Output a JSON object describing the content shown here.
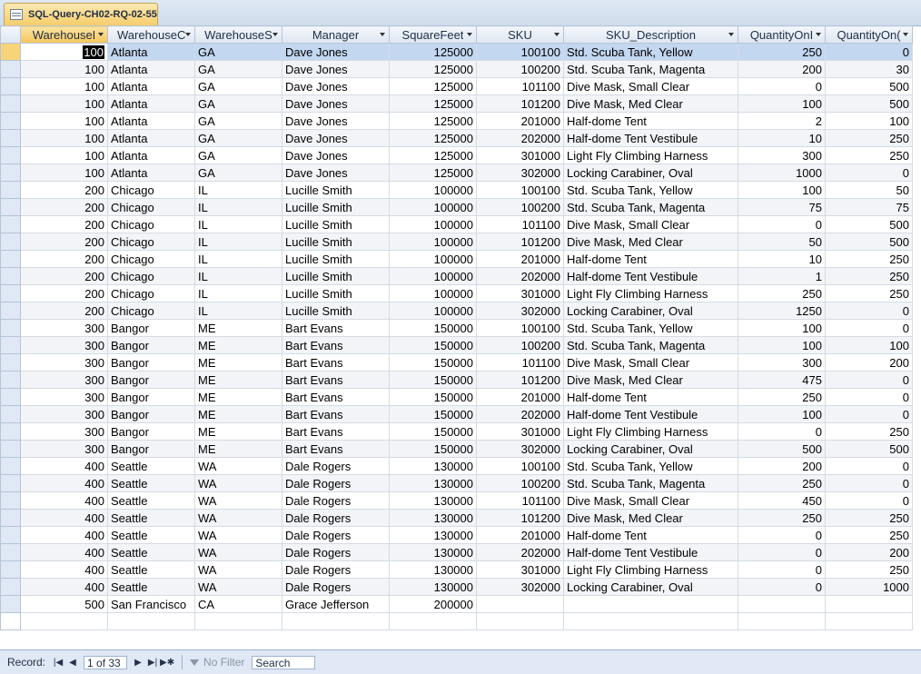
{
  "tab": {
    "title": "SQL-Query-CH02-RQ-02-55",
    "icon": "query-datasheet-icon"
  },
  "columns": [
    {
      "label": "WarehouseI",
      "dropdown": true
    },
    {
      "label": "WarehouseC",
      "dropdown": true
    },
    {
      "label": "WarehouseS",
      "dropdown": true
    },
    {
      "label": "Manager",
      "dropdown": true
    },
    {
      "label": "SquareFeet",
      "dropdown": true
    },
    {
      "label": "SKU",
      "dropdown": true
    },
    {
      "label": "SKU_Description",
      "dropdown": true
    },
    {
      "label": "QuantityOnI",
      "dropdown": true
    },
    {
      "label": "QuantityOn(",
      "dropdown": true
    }
  ],
  "rows": [
    [
      "100",
      "Atlanta",
      "GA",
      "Dave Jones",
      "125000",
      "100100",
      "Std. Scuba Tank, Yellow",
      "250",
      "0"
    ],
    [
      "100",
      "Atlanta",
      "GA",
      "Dave Jones",
      "125000",
      "100200",
      "Std. Scuba Tank, Magenta",
      "200",
      "30"
    ],
    [
      "100",
      "Atlanta",
      "GA",
      "Dave Jones",
      "125000",
      "101100",
      "Dive Mask, Small Clear",
      "0",
      "500"
    ],
    [
      "100",
      "Atlanta",
      "GA",
      "Dave Jones",
      "125000",
      "101200",
      "Dive Mask, Med Clear",
      "100",
      "500"
    ],
    [
      "100",
      "Atlanta",
      "GA",
      "Dave Jones",
      "125000",
      "201000",
      "Half-dome Tent",
      "2",
      "100"
    ],
    [
      "100",
      "Atlanta",
      "GA",
      "Dave Jones",
      "125000",
      "202000",
      "Half-dome Tent Vestibule",
      "10",
      "250"
    ],
    [
      "100",
      "Atlanta",
      "GA",
      "Dave Jones",
      "125000",
      "301000",
      "Light Fly Climbing Harness",
      "300",
      "250"
    ],
    [
      "100",
      "Atlanta",
      "GA",
      "Dave Jones",
      "125000",
      "302000",
      "Locking Carabiner, Oval",
      "1000",
      "0"
    ],
    [
      "200",
      "Chicago",
      "IL",
      "Lucille Smith",
      "100000",
      "100100",
      "Std. Scuba Tank, Yellow",
      "100",
      "50"
    ],
    [
      "200",
      "Chicago",
      "IL",
      "Lucille Smith",
      "100000",
      "100200",
      "Std. Scuba Tank, Magenta",
      "75",
      "75"
    ],
    [
      "200",
      "Chicago",
      "IL",
      "Lucille Smith",
      "100000",
      "101100",
      "Dive Mask, Small Clear",
      "0",
      "500"
    ],
    [
      "200",
      "Chicago",
      "IL",
      "Lucille Smith",
      "100000",
      "101200",
      "Dive Mask, Med Clear",
      "50",
      "500"
    ],
    [
      "200",
      "Chicago",
      "IL",
      "Lucille Smith",
      "100000",
      "201000",
      "Half-dome Tent",
      "10",
      "250"
    ],
    [
      "200",
      "Chicago",
      "IL",
      "Lucille Smith",
      "100000",
      "202000",
      "Half-dome Tent Vestibule",
      "1",
      "250"
    ],
    [
      "200",
      "Chicago",
      "IL",
      "Lucille Smith",
      "100000",
      "301000",
      "Light Fly Climbing Harness",
      "250",
      "250"
    ],
    [
      "200",
      "Chicago",
      "IL",
      "Lucille Smith",
      "100000",
      "302000",
      "Locking Carabiner, Oval",
      "1250",
      "0"
    ],
    [
      "300",
      "Bangor",
      "ME",
      "Bart Evans",
      "150000",
      "100100",
      "Std. Scuba Tank, Yellow",
      "100",
      "0"
    ],
    [
      "300",
      "Bangor",
      "ME",
      "Bart Evans",
      "150000",
      "100200",
      "Std. Scuba Tank, Magenta",
      "100",
      "100"
    ],
    [
      "300",
      "Bangor",
      "ME",
      "Bart Evans",
      "150000",
      "101100",
      "Dive Mask, Small Clear",
      "300",
      "200"
    ],
    [
      "300",
      "Bangor",
      "ME",
      "Bart Evans",
      "150000",
      "101200",
      "Dive Mask, Med Clear",
      "475",
      "0"
    ],
    [
      "300",
      "Bangor",
      "ME",
      "Bart Evans",
      "150000",
      "201000",
      "Half-dome Tent",
      "250",
      "0"
    ],
    [
      "300",
      "Bangor",
      "ME",
      "Bart Evans",
      "150000",
      "202000",
      "Half-dome Tent Vestibule",
      "100",
      "0"
    ],
    [
      "300",
      "Bangor",
      "ME",
      "Bart Evans",
      "150000",
      "301000",
      "Light Fly Climbing Harness",
      "0",
      "250"
    ],
    [
      "300",
      "Bangor",
      "ME",
      "Bart Evans",
      "150000",
      "302000",
      "Locking Carabiner, Oval",
      "500",
      "500"
    ],
    [
      "400",
      "Seattle",
      "WA",
      "Dale Rogers",
      "130000",
      "100100",
      "Std. Scuba Tank, Yellow",
      "200",
      "0"
    ],
    [
      "400",
      "Seattle",
      "WA",
      "Dale Rogers",
      "130000",
      "100200",
      "Std. Scuba Tank, Magenta",
      "250",
      "0"
    ],
    [
      "400",
      "Seattle",
      "WA",
      "Dale Rogers",
      "130000",
      "101100",
      "Dive Mask, Small Clear",
      "450",
      "0"
    ],
    [
      "400",
      "Seattle",
      "WA",
      "Dale Rogers",
      "130000",
      "101200",
      "Dive Mask, Med Clear",
      "250",
      "250"
    ],
    [
      "400",
      "Seattle",
      "WA",
      "Dale Rogers",
      "130000",
      "201000",
      "Half-dome Tent",
      "0",
      "250"
    ],
    [
      "400",
      "Seattle",
      "WA",
      "Dale Rogers",
      "130000",
      "202000",
      "Half-dome Tent Vestibule",
      "0",
      "200"
    ],
    [
      "400",
      "Seattle",
      "WA",
      "Dale Rogers",
      "130000",
      "301000",
      "Light Fly Climbing Harness",
      "0",
      "250"
    ],
    [
      "400",
      "Seattle",
      "WA",
      "Dale Rogers",
      "130000",
      "302000",
      "Locking Carabiner, Oval",
      "0",
      "1000"
    ],
    [
      "500",
      "San Francisco",
      "CA",
      "Grace Jefferson",
      "200000",
      "",
      "",
      "",
      ""
    ]
  ],
  "numeric_columns": [
    0,
    4,
    5,
    7,
    8
  ],
  "new_row_marker": "✱",
  "navigation": {
    "record_label": "Record:",
    "current_record": "1 of 33",
    "filter_label": "No Filter",
    "search_placeholder": "Search"
  },
  "colors": {
    "header_bg": "#dfe8f4",
    "selected_tab": "#f6cd6a",
    "current_row": "#c3d7f1"
  }
}
